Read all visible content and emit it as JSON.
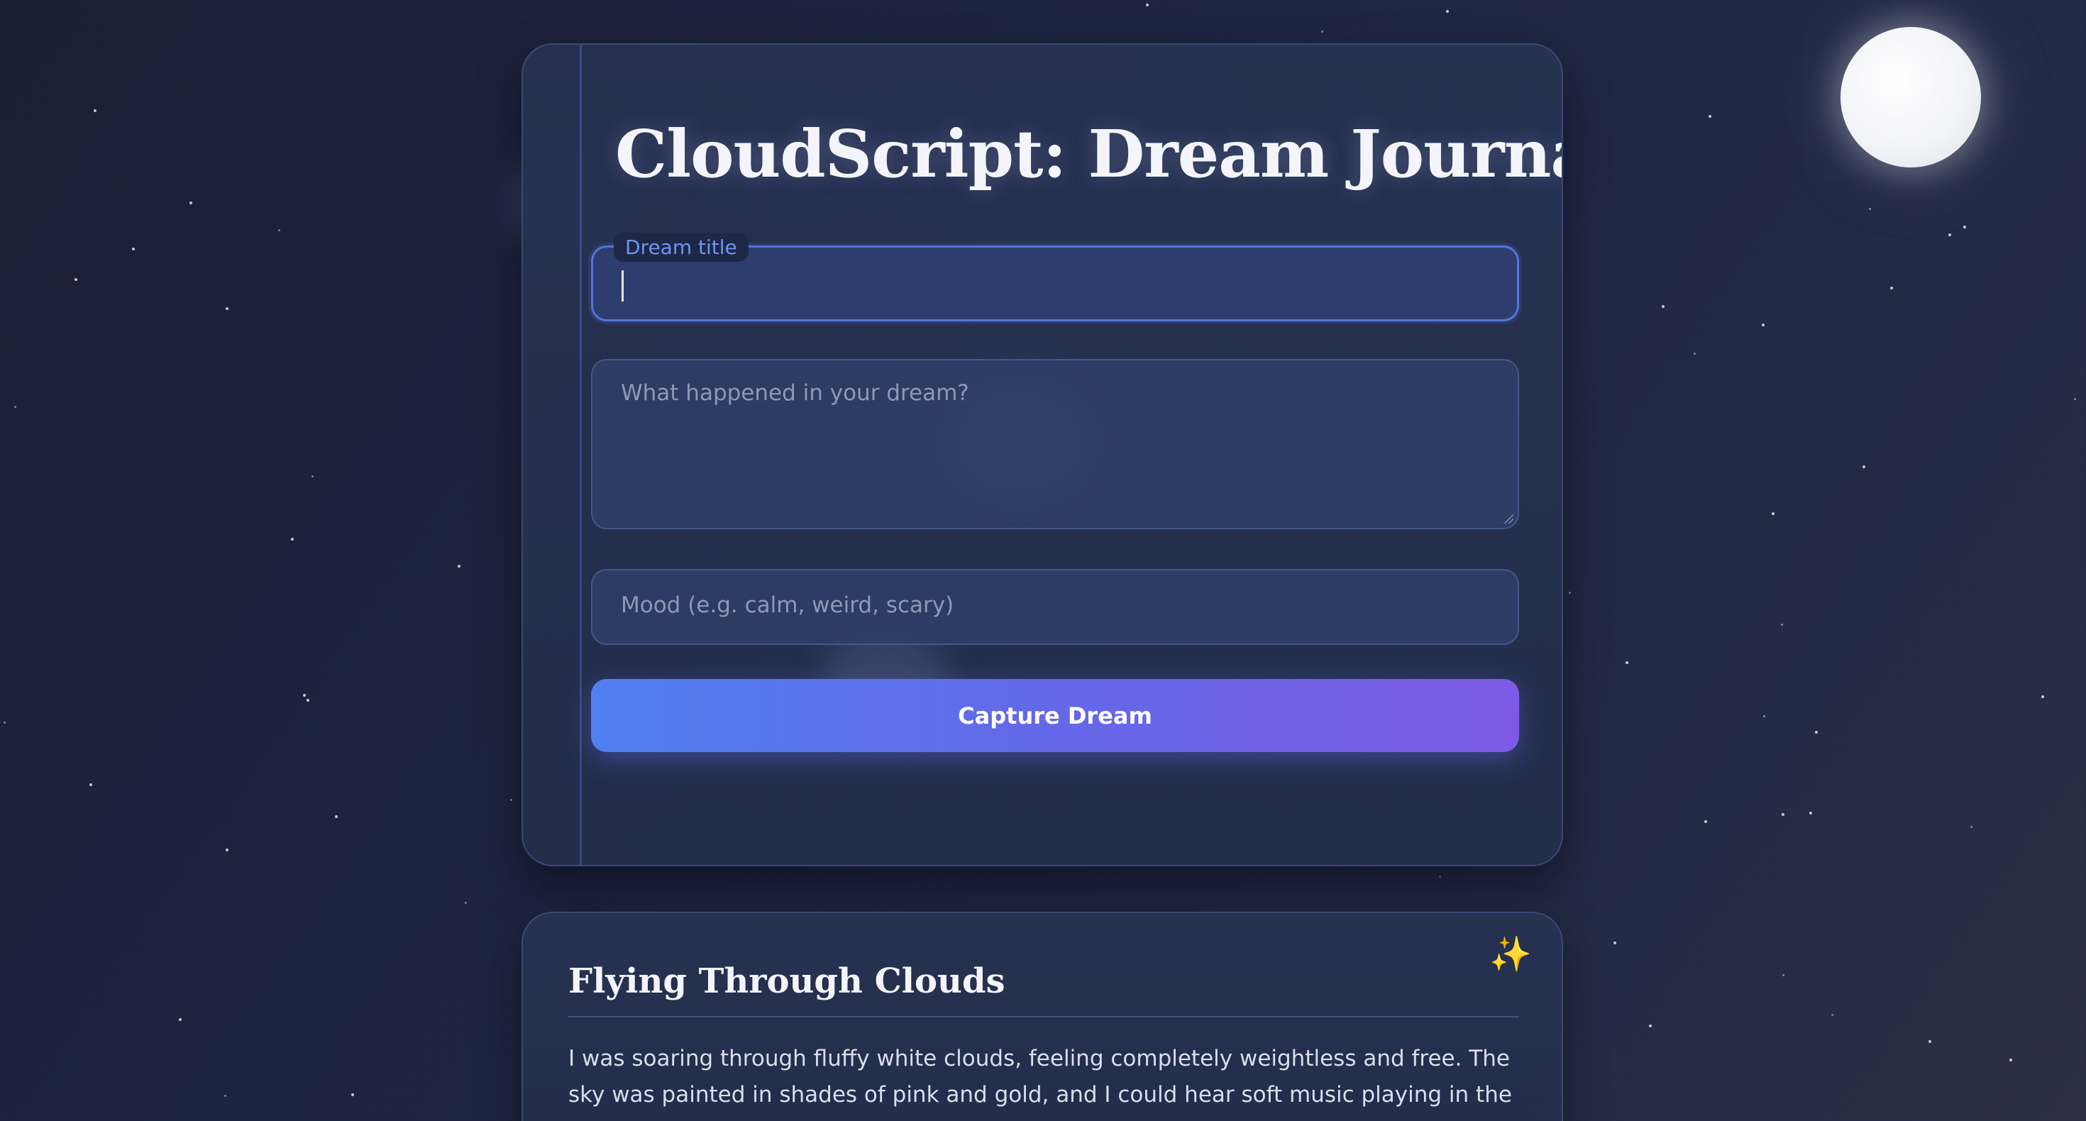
{
  "app": {
    "title": "CloudScript: Dream Journal"
  },
  "form": {
    "title_field": {
      "label": "Dream title",
      "value": ""
    },
    "description_field": {
      "placeholder": "What happened in your dream?",
      "value": ""
    },
    "mood_field": {
      "placeholder": "Mood (e.g. calm, weird, scary)",
      "value": ""
    },
    "submit_label": "Capture Dream"
  },
  "entries": [
    {
      "title": "Flying Through Clouds",
      "icon": "sparkles-icon",
      "body": "I was soaring through fluffy white clouds, feeling completely weightless and free. The sky was painted in shades of pink and gold, and I could hear soft music playing in the"
    }
  ],
  "colors": {
    "accent_start": "#4f7ff0",
    "accent_end": "#7e5be6",
    "focus_label": "#6e93f0",
    "sparkle": "#e3c477"
  }
}
